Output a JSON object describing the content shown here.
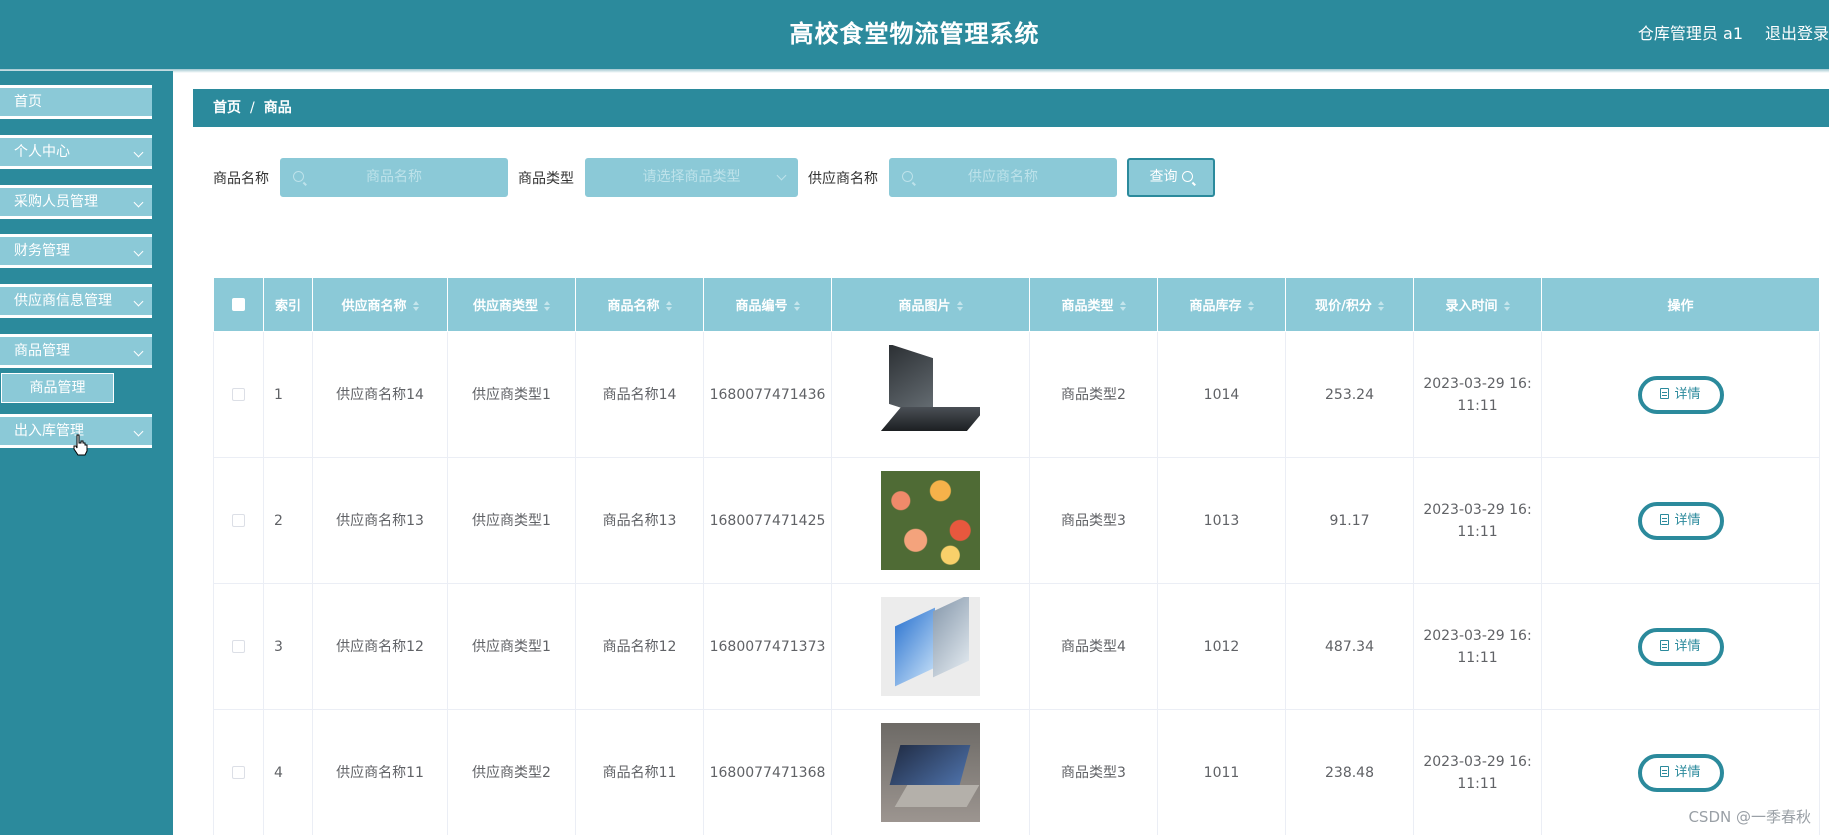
{
  "header": {
    "title": "高校食堂物流管理系统",
    "user": "仓库管理员 a1",
    "logout": "退出登录"
  },
  "sidebar": {
    "items": [
      {
        "label": "首页",
        "has_chevron": false
      },
      {
        "label": "个人中心",
        "has_chevron": true
      },
      {
        "label": "采购人员管理",
        "has_chevron": true
      },
      {
        "label": "财务管理",
        "has_chevron": true
      },
      {
        "label": "供应商信息管理",
        "has_chevron": true
      },
      {
        "label": "商品管理",
        "has_chevron": true
      },
      {
        "label": "出入库管理",
        "has_chevron": true
      }
    ],
    "sub_item": "商品管理"
  },
  "breadcrumb": {
    "home": "首页",
    "separator": "/",
    "current": "商品"
  },
  "search": {
    "product_name_label": "商品名称",
    "product_name_placeholder": "商品名称",
    "product_type_label": "商品类型",
    "product_type_placeholder": "请选择商品类型",
    "supplier_name_label": "供应商名称",
    "supplier_name_placeholder": "供应商名称",
    "query_button": "查询"
  },
  "table": {
    "headers": {
      "index": "索引",
      "supplier_name": "供应商名称",
      "supplier_type": "供应商类型",
      "product_name": "商品名称",
      "product_code": "商品编号",
      "product_image": "商品图片",
      "product_type": "商品类型",
      "stock": "商品库存",
      "price": "现价/积分",
      "entry_time": "录入时间",
      "actions": "操作"
    },
    "rows": [
      {
        "index": "1",
        "supplier_name": "供应商名称14",
        "supplier_type": "供应商类型1",
        "product_name": "商品名称14",
        "product_code": "1680077471436",
        "image": "laptop",
        "product_type": "商品类型2",
        "stock": "1014",
        "price": "253.24",
        "entry_time_1": "2023-03-29 16:",
        "entry_time_2": "11:11",
        "detail": "详情"
      },
      {
        "index": "2",
        "supplier_name": "供应商名称13",
        "supplier_type": "供应商类型1",
        "product_name": "商品名称13",
        "product_code": "1680077471425",
        "image": "flowers",
        "product_type": "商品类型3",
        "stock": "1013",
        "price": "91.17",
        "entry_time_1": "2023-03-29 16:",
        "entry_time_2": "11:11",
        "detail": "详情"
      },
      {
        "index": "3",
        "supplier_name": "供应商名称12",
        "supplier_type": "供应商类型1",
        "product_name": "商品名称12",
        "product_code": "1680077471373",
        "image": "surface",
        "product_type": "商品类型4",
        "stock": "1012",
        "price": "487.34",
        "entry_time_1": "2023-03-29 16:",
        "entry_time_2": "11:11",
        "detail": "详情"
      },
      {
        "index": "4",
        "supplier_name": "供应商名称11",
        "supplier_type": "供应商类型2",
        "product_name": "商品名称11",
        "product_code": "1680077471368",
        "image": "desk",
        "product_type": "商品类型3",
        "stock": "1011",
        "price": "238.48",
        "entry_time_1": "2023-03-29 16:",
        "entry_time_2": "11:11",
        "detail": "详情"
      }
    ]
  },
  "watermark": "CSDN @一季春秋",
  "colors": {
    "primary": "#2b8a9c",
    "light": "#8bc9d7"
  }
}
